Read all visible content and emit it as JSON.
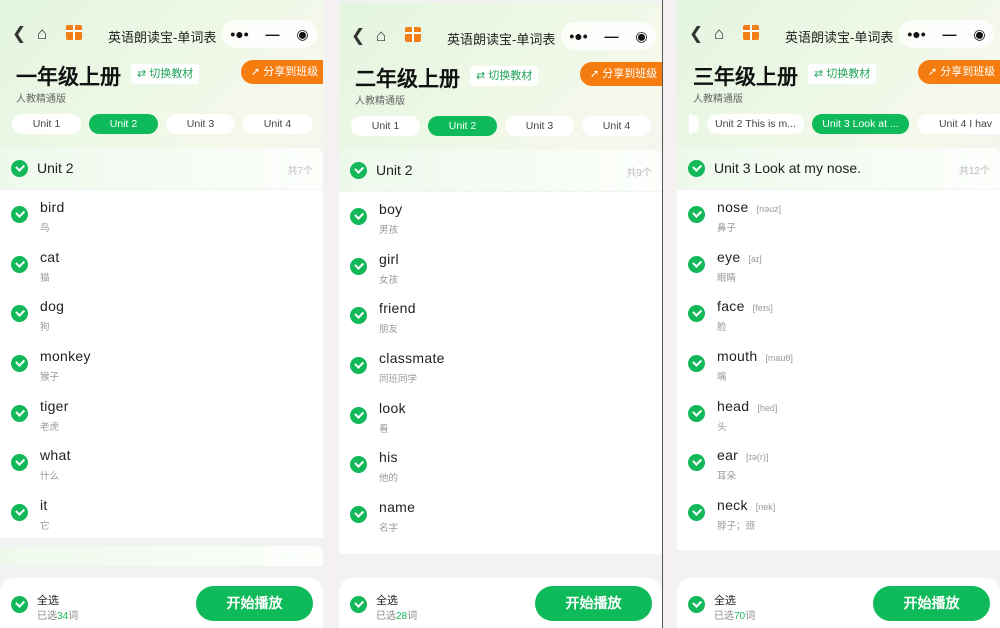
{
  "app_title": "英语朗读宝-单词表",
  "switch_label": "切换教材",
  "share_label": "分享到班级",
  "select_all_label": "全选",
  "selected_prefix": "已选",
  "selected_suffix": "词",
  "play_label": "开始播放",
  "accent_color": "#0fba5a",
  "share_color": "#f67c0f",
  "panels": [
    {
      "grade": "一年级上册",
      "edition": "人教精通版",
      "tabs": [
        {
          "label": "Unit 1"
        },
        {
          "label": "Unit 2",
          "active": true
        },
        {
          "label": "Unit 3"
        },
        {
          "label": "Unit 4"
        }
      ],
      "unit_title": "Unit 2",
      "count": "共7个",
      "selected_count": "34",
      "words": [
        {
          "word": "bird",
          "meaning": "鸟"
        },
        {
          "word": "cat",
          "meaning": "猫"
        },
        {
          "word": "dog",
          "meaning": "狗"
        },
        {
          "word": "monkey",
          "meaning": "猴子"
        },
        {
          "word": "tiger",
          "meaning": "老虎"
        },
        {
          "word": "what",
          "meaning": "什么"
        },
        {
          "word": "it",
          "meaning": "它"
        }
      ]
    },
    {
      "grade": "二年级上册",
      "edition": "人教精通版",
      "tabs": [
        {
          "label": "Unit 1"
        },
        {
          "label": "Unit 2",
          "active": true
        },
        {
          "label": "Unit 3"
        },
        {
          "label": "Unit 4"
        }
      ],
      "unit_title": "Unit 2",
      "count": "共9个",
      "selected_count": "28",
      "words": [
        {
          "word": "boy",
          "meaning": "男孩"
        },
        {
          "word": "girl",
          "meaning": "女孩"
        },
        {
          "word": "friend",
          "meaning": "朋友"
        },
        {
          "word": "classmate",
          "meaning": "同班同学"
        },
        {
          "word": "look",
          "meaning": "看"
        },
        {
          "word": "his",
          "meaning": "他的"
        },
        {
          "word": "name",
          "meaning": "名字"
        }
      ]
    },
    {
      "grade": "三年级上册",
      "edition": "人教精通版",
      "tabs": [
        {
          "label": "."
        },
        {
          "label": "Unit 2 This is m..."
        },
        {
          "label": "Unit 3 Look at ...",
          "active": true
        },
        {
          "label": "Unit 4 I hav"
        }
      ],
      "unit_title": "Unit 3 Look at my nose.",
      "count": "共12个",
      "selected_count": "70",
      "words": [
        {
          "word": "nose",
          "phonetic": "[nəuz]",
          "meaning": "鼻子"
        },
        {
          "word": "eye",
          "phonetic": "[aɪ]",
          "meaning": "眼睛"
        },
        {
          "word": "face",
          "phonetic": "[feɪs]",
          "meaning": "脸"
        },
        {
          "word": "mouth",
          "phonetic": "[mauθ]",
          "meaning": "嘴"
        },
        {
          "word": "head",
          "phonetic": "[hed]",
          "meaning": "头"
        },
        {
          "word": "ear",
          "phonetic": "[ɪə(r)]",
          "meaning": "耳朵"
        },
        {
          "word": "neck",
          "phonetic": "[nek]",
          "meaning": "脖子；颈"
        }
      ]
    }
  ]
}
